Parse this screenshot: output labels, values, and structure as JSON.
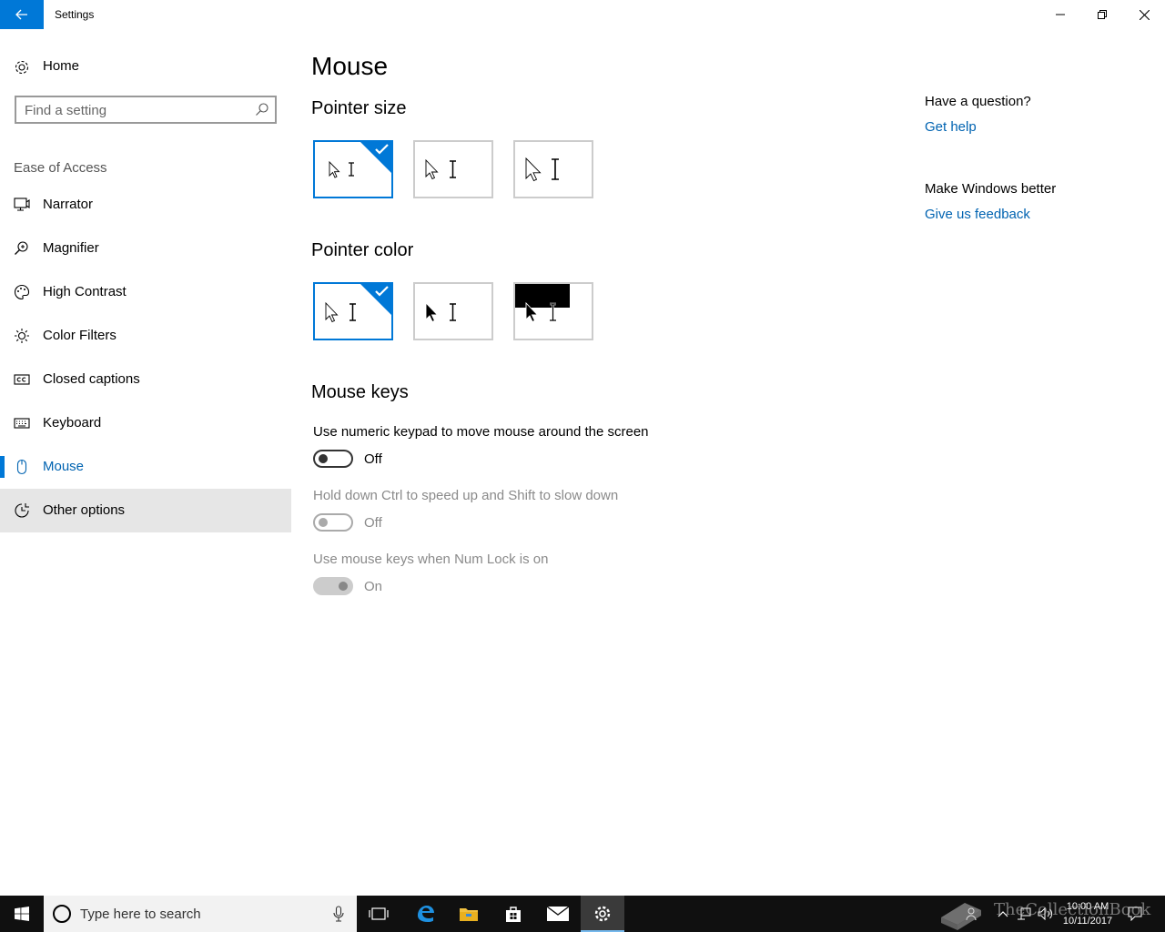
{
  "window": {
    "title": "Settings"
  },
  "sidebar": {
    "home_label": "Home",
    "search_placeholder": "Find a setting",
    "section_label": "Ease of Access",
    "items": [
      {
        "label": "Narrator",
        "icon": "narrator-icon"
      },
      {
        "label": "Magnifier",
        "icon": "magnifier-icon"
      },
      {
        "label": "High Contrast",
        "icon": "palette-icon"
      },
      {
        "label": "Color Filters",
        "icon": "sun-icon"
      },
      {
        "label": "Closed captions",
        "icon": "cc-icon"
      },
      {
        "label": "Keyboard",
        "icon": "keyboard-icon"
      },
      {
        "label": "Mouse",
        "icon": "mouse-icon",
        "selected": true
      },
      {
        "label": "Other options",
        "icon": "other-options-icon",
        "hovered": true
      }
    ]
  },
  "main": {
    "title": "Mouse",
    "pointer_size": {
      "heading": "Pointer size",
      "options": [
        "small",
        "medium",
        "large"
      ],
      "selected": 0
    },
    "pointer_color": {
      "heading": "Pointer color",
      "options": [
        "white",
        "black",
        "inverted"
      ],
      "selected": 0
    },
    "mouse_keys": {
      "heading": "Mouse keys",
      "settings": [
        {
          "label": "Use numeric keypad to move mouse around the screen",
          "state": "Off",
          "enabled": true,
          "on": false
        },
        {
          "label": "Hold down Ctrl to speed up and Shift to slow down",
          "state": "Off",
          "enabled": false,
          "on": false
        },
        {
          "label": "Use mouse keys when Num Lock is on",
          "state": "On",
          "enabled": false,
          "on": true
        }
      ]
    }
  },
  "aside": {
    "question_heading": "Have a question?",
    "help_link": "Get help",
    "feedback_heading": "Make Windows better",
    "feedback_link": "Give us feedback"
  },
  "taskbar": {
    "search_placeholder": "Type here to search",
    "time": "10:00 AM",
    "date": "10/11/2017",
    "watermark": "TheCollectionBook"
  },
  "colors": {
    "accent": "#0078d7",
    "link": "#0063b1",
    "taskbar": "#101010"
  }
}
